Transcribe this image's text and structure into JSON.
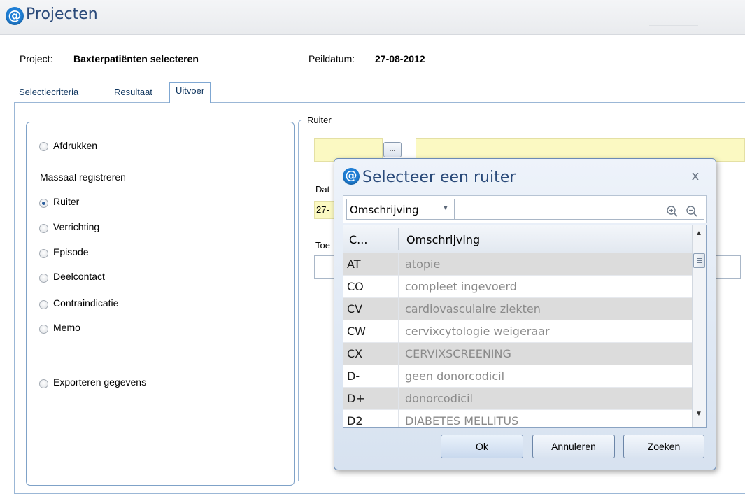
{
  "window": {
    "title": "Projecten",
    "logo_glyph": "@"
  },
  "project": {
    "project_label": "Project:",
    "project_value": "Baxterpatiënten selecteren",
    "peildatum_label": "Peildatum:",
    "peildatum_value": "27-08-2012"
  },
  "tabs": [
    {
      "label": "Selectiecriteria",
      "active": false
    },
    {
      "label": "Resultaat",
      "active": false
    },
    {
      "label": "Uitvoer",
      "active": true
    }
  ],
  "options": {
    "afdrukken": "Afdrukken",
    "massaal_heading": "Massaal registreren",
    "items": [
      "Ruiter",
      "Verrichting",
      "Episode",
      "Deelcontact",
      "Contraindicatie",
      "Memo"
    ],
    "selected": "Ruiter",
    "exporteren": "Exporteren gegevens"
  },
  "ruiter_group": {
    "label": "Ruiter",
    "browse_label": "...",
    "date_label_fragment": "Dat",
    "date_value_fragment": "27-",
    "toe_label_fragment": "Toe"
  },
  "dialog": {
    "title": "Selecteer een ruiter",
    "close_glyph": "x",
    "filter": {
      "field": "Omschrijving",
      "query": ""
    },
    "grid": {
      "columns": [
        "C...",
        "Omschrijving"
      ],
      "rows": [
        {
          "code": "AT",
          "desc": "atopie"
        },
        {
          "code": "CO",
          "desc": "compleet ingevoerd"
        },
        {
          "code": "CV",
          "desc": "cardiovasculaire ziekten"
        },
        {
          "code": "CW",
          "desc": "cervixcytologie weigeraar"
        },
        {
          "code": "CX",
          "desc": "CERVIXSCREENING"
        },
        {
          "code": "D-",
          "desc": "geen donorcodicil"
        },
        {
          "code": "D+",
          "desc": "donorcodicil"
        },
        {
          "code": "D2",
          "desc": "DIABETES MELLITUS"
        }
      ]
    },
    "buttons": {
      "ok": "Ok",
      "cancel": "Annuleren",
      "search": "Zoeken"
    }
  },
  "colors": {
    "accent": "#1f7fd6",
    "title_text": "#2a4a7a",
    "input_yellow": "#fbf9c2",
    "row_alt": "#dcdcdc"
  }
}
